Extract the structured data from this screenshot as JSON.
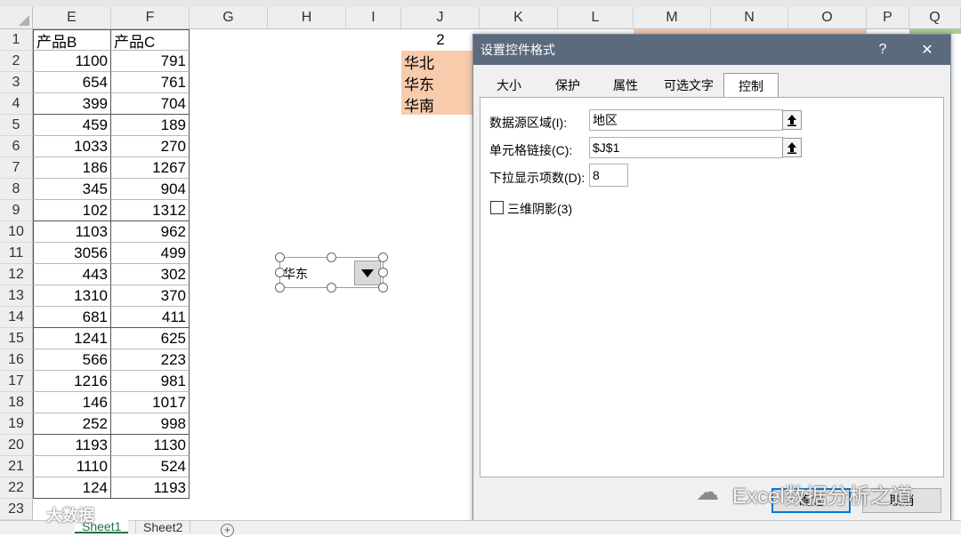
{
  "columns": [
    "E",
    "F",
    "G",
    "H",
    "I",
    "J",
    "K",
    "L",
    "M",
    "N",
    "O",
    "P",
    "Q"
  ],
  "rows": [
    "1",
    "2",
    "3",
    "4",
    "5",
    "6",
    "7",
    "8",
    "9",
    "10",
    "11",
    "12",
    "13",
    "14",
    "15",
    "16",
    "17",
    "18",
    "19",
    "20",
    "21",
    "22",
    "23"
  ],
  "table": {
    "header_b": "产品B",
    "header_c": "产品C",
    "data": [
      [
        "1100",
        "791"
      ],
      [
        "654",
        "761"
      ],
      [
        "399",
        "704"
      ],
      [
        "459",
        "189"
      ],
      [
        "1033",
        "270"
      ],
      [
        "186",
        "1267"
      ],
      [
        "345",
        "904"
      ],
      [
        "102",
        "1312"
      ],
      [
        "1103",
        "962"
      ],
      [
        "3056",
        "499"
      ],
      [
        "443",
        "302"
      ],
      [
        "1310",
        "370"
      ],
      [
        "681",
        "411"
      ],
      [
        "1241",
        "625"
      ],
      [
        "566",
        "223"
      ],
      [
        "1216",
        "981"
      ],
      [
        "146",
        "1017"
      ],
      [
        "252",
        "998"
      ],
      [
        "1193",
        "1130"
      ],
      [
        "1110",
        "524"
      ],
      [
        "124",
        "1193"
      ]
    ]
  },
  "j1_value": "2",
  "regions": [
    "华北",
    "华东",
    "华南"
  ],
  "combobox": {
    "value": "华东"
  },
  "dialog": {
    "title": "设置控件格式",
    "help": "?",
    "close": "✕",
    "tabs": [
      "大小",
      "保护",
      "属性",
      "可选文字",
      "控制"
    ],
    "active_tab": "控制",
    "input_range_label": "数据源区域(I):",
    "input_range_value": "地区",
    "cell_link_label": "单元格链接(C):",
    "cell_link_value": "$J$1",
    "dropdown_lines_label": "下拉显示项数(D):",
    "dropdown_lines_value": "8",
    "shading_label": "三维阴影(3)",
    "ok_label": "确定",
    "cancel_label": "取消"
  },
  "sheets": [
    "Sheet1",
    "Sheet2"
  ],
  "watermark_left": "大数据",
  "watermark_right": "Excel数据分析之道",
  "colors": {
    "region_fill": "#f8cbad",
    "titlebar": "#5b6b7d",
    "sheet_active": "#217346"
  }
}
